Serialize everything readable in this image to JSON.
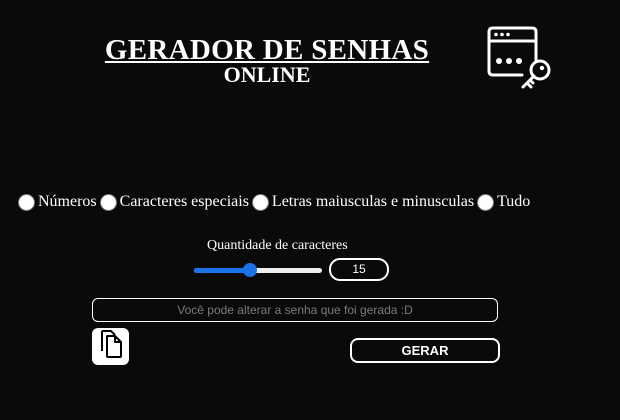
{
  "header": {
    "title": "GERADOR DE SENHAS",
    "subtitle": "ONLINE",
    "logo_icon": "browser-window-key-icon"
  },
  "options": [
    {
      "label": "Números",
      "checked": false
    },
    {
      "label": "Caracteres especiais",
      "checked": false
    },
    {
      "label": "Letras maiusculas e minusculas",
      "checked": false
    },
    {
      "label": "Tudo",
      "checked": false
    }
  ],
  "length": {
    "label": "Quantidade de caracteres",
    "value": "15",
    "slider_fraction": 0.44
  },
  "password": {
    "placeholder": "Você pode alterar a senha que foi gerada :D",
    "value": ""
  },
  "actions": {
    "copy_icon": "copy-icon",
    "generate_label": "GERAR"
  },
  "colors": {
    "background": "#0a0a0a",
    "foreground": "#ffffff",
    "accent": "#1a73e8",
    "placeholder": "#7b7b7b"
  }
}
